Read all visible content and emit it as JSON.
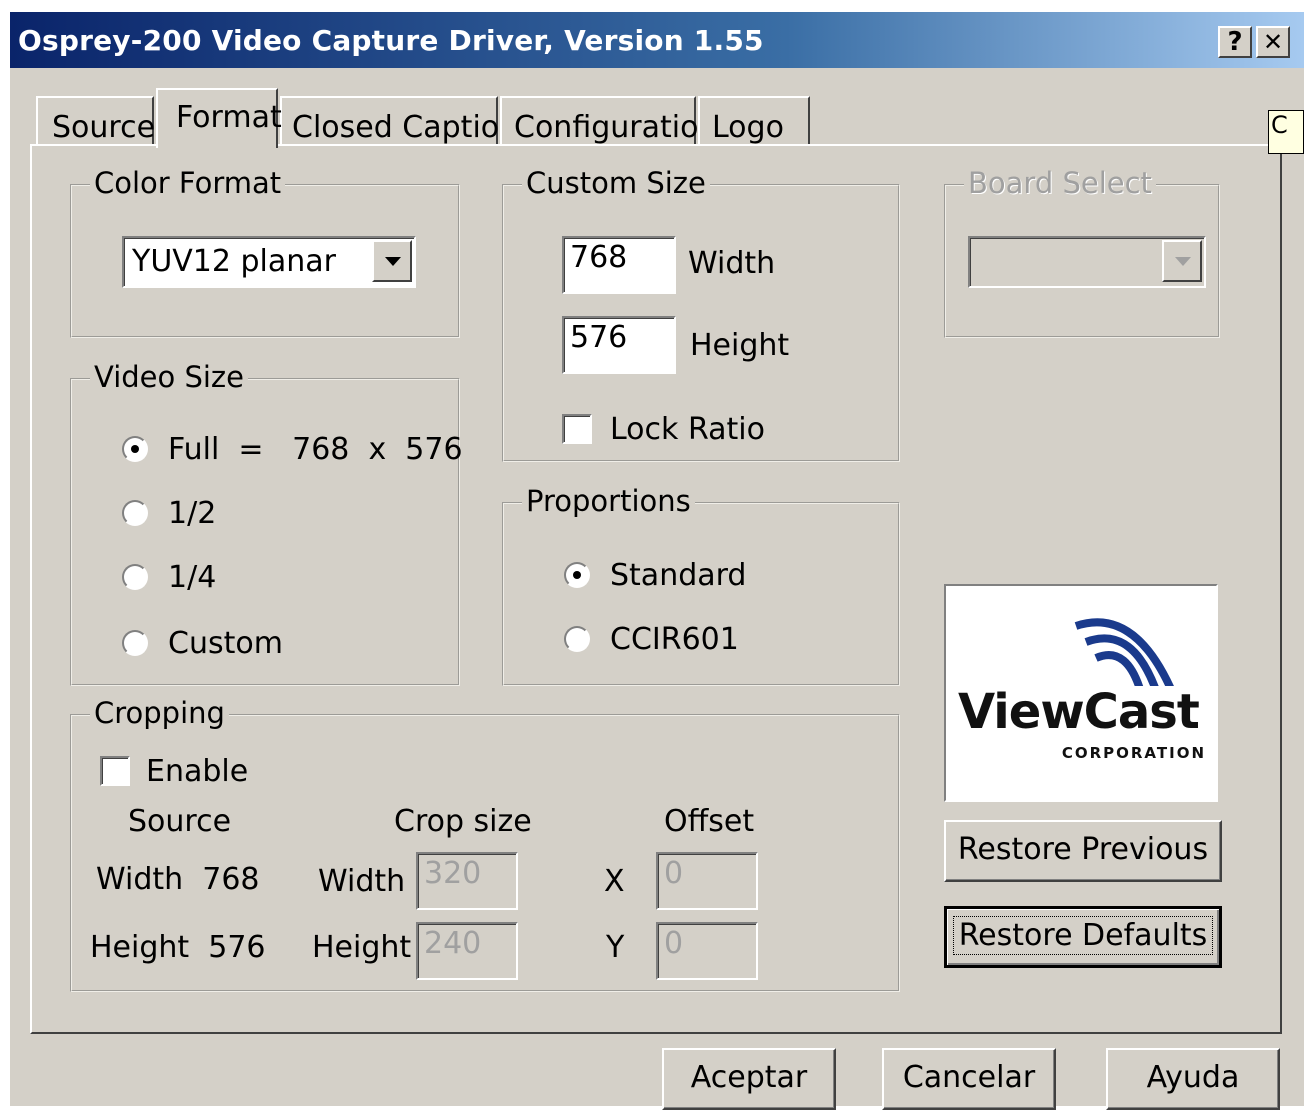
{
  "window": {
    "title": "Osprey-200 Video Capture Driver, Version 1.55",
    "help_label": "?",
    "close_label": "✕"
  },
  "tabs": [
    {
      "label": "Source"
    },
    {
      "label": "Format",
      "selected": true
    },
    {
      "label": "Closed Caption"
    },
    {
      "label": "Configuration"
    },
    {
      "label": "Logo"
    }
  ],
  "tooltip_fragment": "C",
  "color_format": {
    "legend": "Color Format",
    "selected": "YUV12 planar"
  },
  "custom_size": {
    "legend": "Custom Size",
    "width_value": "768",
    "width_label": "Width",
    "height_value": "576",
    "height_label": "Height",
    "lock_ratio_label": "Lock Ratio",
    "lock_ratio_checked": false
  },
  "board_select": {
    "legend": "Board Select",
    "selected": "",
    "disabled": true
  },
  "video_size": {
    "legend": "Video Size",
    "options": [
      {
        "label": "Full  =   768  x  576",
        "selected": true
      },
      {
        "label": "1/2",
        "selected": false
      },
      {
        "label": "1/4",
        "selected": false
      },
      {
        "label": "Custom",
        "selected": false
      }
    ]
  },
  "proportions": {
    "legend": "Proportions",
    "options": [
      {
        "label": "Standard",
        "selected": true
      },
      {
        "label": "CCIR601",
        "selected": false
      }
    ]
  },
  "cropping": {
    "legend": "Cropping",
    "enable_label": "Enable",
    "enable_checked": false,
    "source_header": "Source",
    "crop_size_header": "Crop size",
    "offset_header": "Offset",
    "source_width": "Width  768",
    "source_height": "Height  576",
    "crop_width_label": "Width",
    "crop_height_label": "Height",
    "crop_width_value": "320",
    "crop_height_value": "240",
    "x_label": "X",
    "y_label": "Y",
    "offset_x_value": "0",
    "offset_y_value": "0"
  },
  "logo": {
    "name": "ViewCast",
    "subtitle": "CORPORATION",
    "colors": {
      "arc": "#1a3a8c",
      "text": "#111111"
    }
  },
  "buttons": {
    "restore_previous": "Restore Previous",
    "restore_defaults": "Restore Defaults",
    "ok": "Aceptar",
    "cancel": "Cancelar",
    "help": "Ayuda"
  }
}
